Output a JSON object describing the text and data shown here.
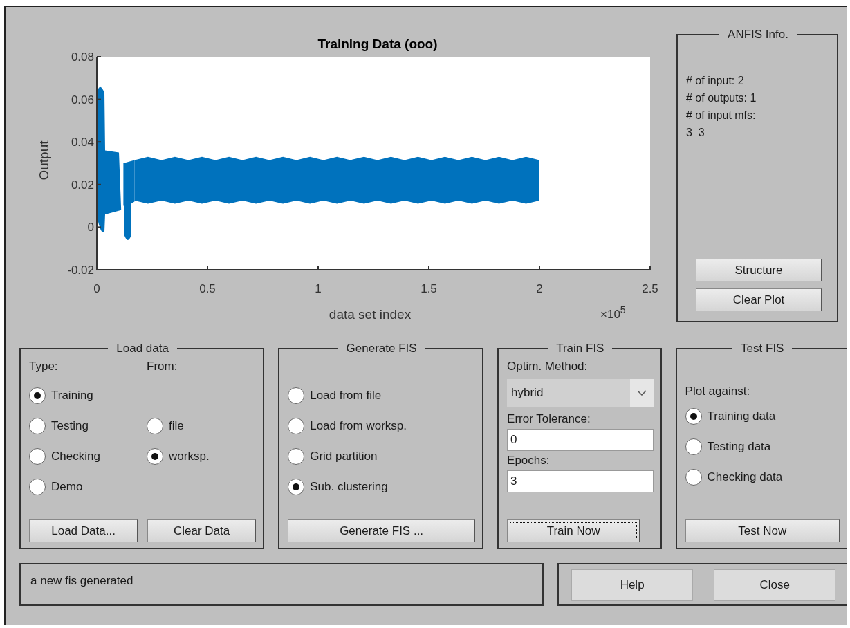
{
  "plot": {
    "title": "Training Data (ooo)",
    "ylabel": "Output",
    "xlabel": "data set index",
    "exponent": "×10$^{5}$",
    "yticks": [
      "0.08",
      "0.06",
      "0.04",
      "0.02",
      "0",
      "-0.02"
    ],
    "xticks": [
      "0",
      "0.5",
      "1",
      "1.5",
      "2",
      "2.5"
    ]
  },
  "anfis_info": {
    "title": "ANFIS Info.",
    "lines": [
      "# of input: 2",
      "# of outputs: 1",
      "# of input mfs:",
      "3  3"
    ],
    "buttons": [
      "Structure",
      "Clear Plot"
    ]
  },
  "load_data": {
    "title": "Load data",
    "type_label": "Type:",
    "from_label": "From:",
    "type_options": [
      {
        "label": "Training",
        "selected": true
      },
      {
        "label": "Testing",
        "selected": false
      },
      {
        "label": "Checking",
        "selected": false
      },
      {
        "label": "Demo",
        "selected": false
      }
    ],
    "from_options": [
      {
        "label": "file",
        "selected": false
      },
      {
        "label": "worksp.",
        "selected": true
      }
    ],
    "buttons": [
      "Load Data...",
      "Clear Data"
    ]
  },
  "generate_fis": {
    "title": "Generate FIS",
    "options": [
      {
        "label": "Load from file",
        "selected": false
      },
      {
        "label": "Load from worksp.",
        "selected": false
      },
      {
        "label": "Grid partition",
        "selected": false
      },
      {
        "label": "Sub. clustering",
        "selected": true
      }
    ],
    "button": "Generate FIS ..."
  },
  "train_fis": {
    "title": "Train FIS",
    "method_label": "Optim. Method:",
    "method": "hybrid",
    "tolerance_label": "Error Tolerance:",
    "tolerance": "0",
    "epochs_label": "Epochs:",
    "epochs": "3",
    "button": {
      "label": "Train Now",
      "focused": true
    }
  },
  "test_fis": {
    "title": "Test FIS",
    "plot_label": "Plot against:",
    "options": [
      {
        "label": "Training data",
        "selected": true
      },
      {
        "label": "Testing data",
        "selected": false
      },
      {
        "label": "Checking data",
        "selected": false
      }
    ],
    "button": "Test Now"
  },
  "status": "a new fis generated",
  "footer_buttons": [
    "Help",
    "Close"
  ]
}
